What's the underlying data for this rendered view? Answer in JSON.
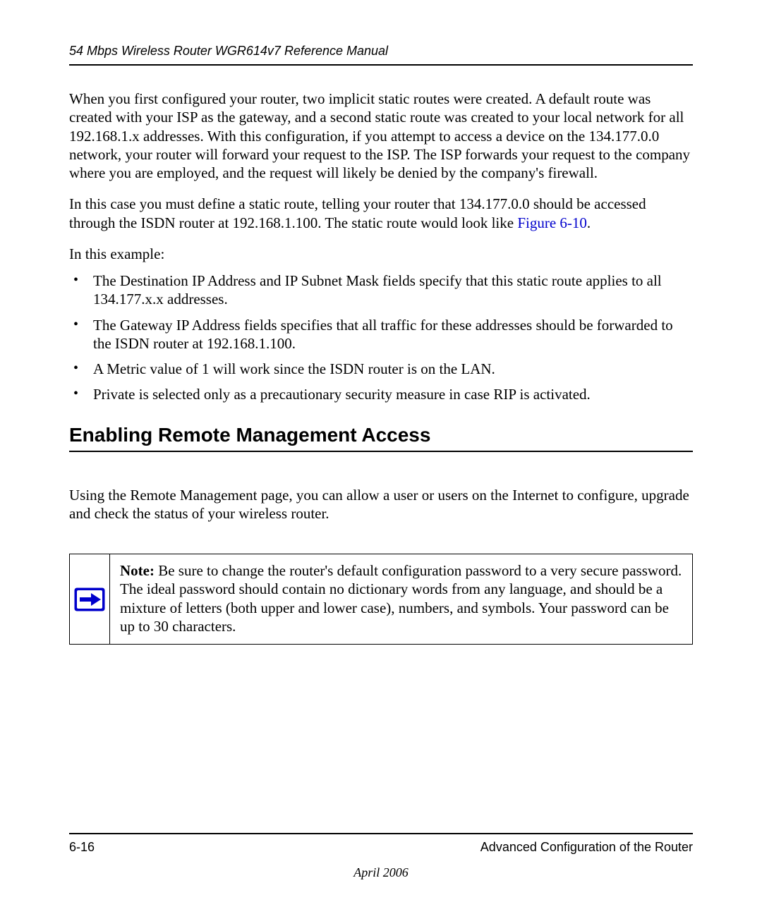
{
  "header": {
    "title": "54 Mbps Wireless Router WGR614v7 Reference Manual"
  },
  "paragraphs": {
    "p1": "When you first configured your router, two implicit static routes were created. A default route was created with your ISP as the gateway, and a second static route was created to your local network for all 192.168.1.x addresses. With this configuration, if you attempt to access a device on the 134.177.0.0 network, your router will forward your request to the ISP. The ISP forwards your request to the company where you are employed, and the request will likely be denied by the company's firewall.",
    "p2_before_link": "In this case you must define a static route, telling your router that 134.177.0.0 should be accessed through the ISDN router at 192.168.1.100. The static route would look like ",
    "p2_link": "Figure 6-10",
    "p2_after_link": ".",
    "p3": "In this example:"
  },
  "bullets": [
    "The Destination IP Address and IP Subnet Mask fields specify that this static route applies to all 134.177.x.x addresses.",
    "The Gateway IP Address fields specifies that all traffic for these addresses should be forwarded to the ISDN router at 192.168.1.100.",
    "A Metric value of 1 will work since the ISDN router is on the LAN.",
    "Private is selected only as a precautionary security measure in case RIP is activated."
  ],
  "section_heading": "Enabling Remote Management Access",
  "section_para": "Using the Remote Management page, you can allow a user or users on the Internet to configure, upgrade and check the status of your wireless router.",
  "note": {
    "label": "Note:",
    "text": " Be sure to change the router's default configuration password to a very secure password. The ideal password should contain no dictionary words from any language, and should be a mixture of letters (both upper and lower case), numbers, and symbols. Your password can be up to 30 characters."
  },
  "footer": {
    "page_number": "6-16",
    "chapter": "Advanced Configuration of the Router",
    "date": "April 2006"
  }
}
